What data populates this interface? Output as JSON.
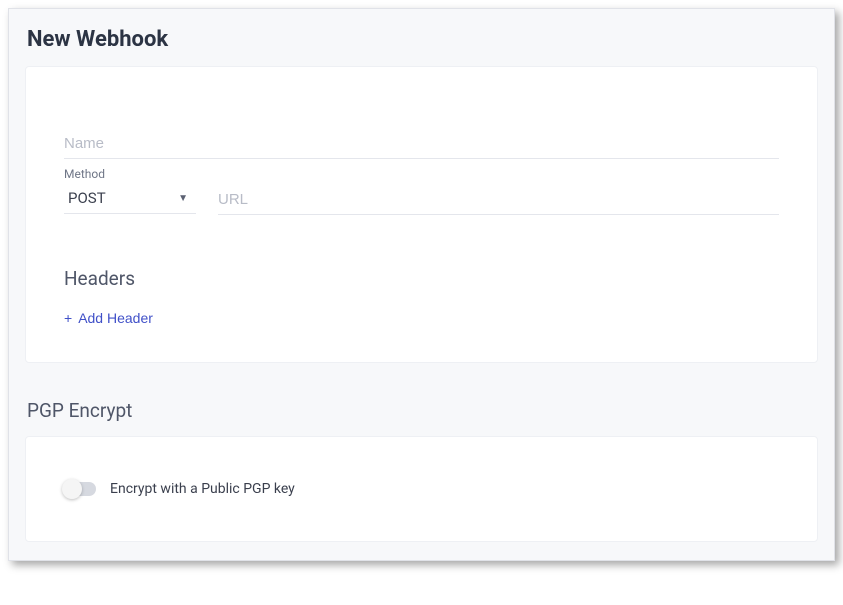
{
  "page": {
    "title": "New Webhook"
  },
  "form": {
    "name": {
      "placeholder": "Name",
      "value": ""
    },
    "method": {
      "label": "Method",
      "value": "POST"
    },
    "url": {
      "placeholder": "URL",
      "value": ""
    },
    "headers": {
      "title": "Headers",
      "add_label": "Add Header"
    }
  },
  "pgp": {
    "title": "PGP Encrypt",
    "toggle_label": "Encrypt with a Public PGP key",
    "enabled": false
  }
}
